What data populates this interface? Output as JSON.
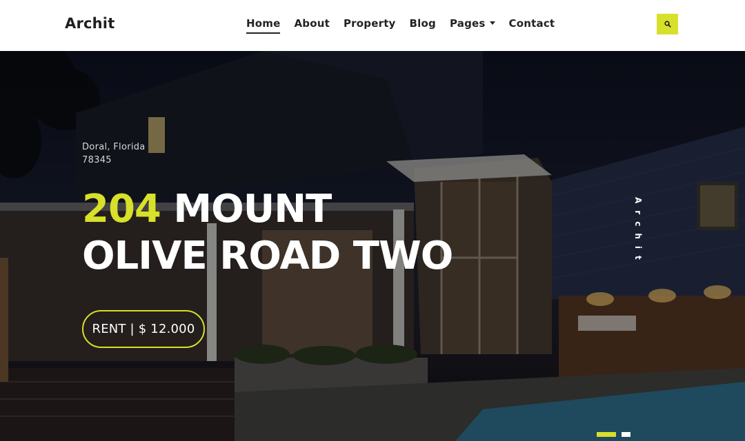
{
  "header": {
    "logo": "Archit",
    "nav": [
      {
        "label": "Home",
        "active": true
      },
      {
        "label": "About"
      },
      {
        "label": "Property"
      },
      {
        "label": "Blog"
      },
      {
        "label": "Pages",
        "has_dropdown": true
      },
      {
        "label": "Contact"
      }
    ],
    "search_icon": "search-icon"
  },
  "hero": {
    "address_line1": "Doral, Florida",
    "address_line2": "78345",
    "title_accent": "204",
    "title_rest_line1": "MOUNT",
    "title_line2": "OLIVE ROAD TWO",
    "cta": "RENT | $ 12.000",
    "side_brand": "Archit",
    "slider": {
      "slides": 2,
      "active_index": 0
    }
  },
  "colors": {
    "accent": "#d7e02a",
    "nav_text": "#222222",
    "hero_text": "#ffffff"
  }
}
